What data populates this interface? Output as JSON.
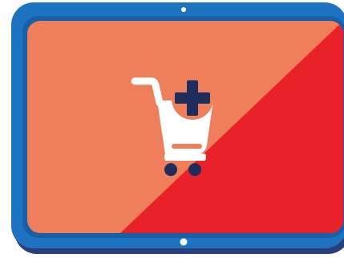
{
  "illustration": {
    "device": "tablet-icon",
    "glyph": "add-to-cart-icon",
    "badge": "plus-icon"
  },
  "colors": {
    "frame_blue": "#1E72C2",
    "frame_shadow": "#2A3E7C",
    "frame_edge": "#175FA6",
    "screen_salmon": "#EF7E5B",
    "screen_red": "#E82228",
    "cart_white": "#FFFFFF",
    "cart_accent": "#EF7E5B",
    "wheels_navy": "#1E2D5C",
    "plus_navy": "#1E2D5C",
    "camera_dot": "#FFFFFF"
  }
}
